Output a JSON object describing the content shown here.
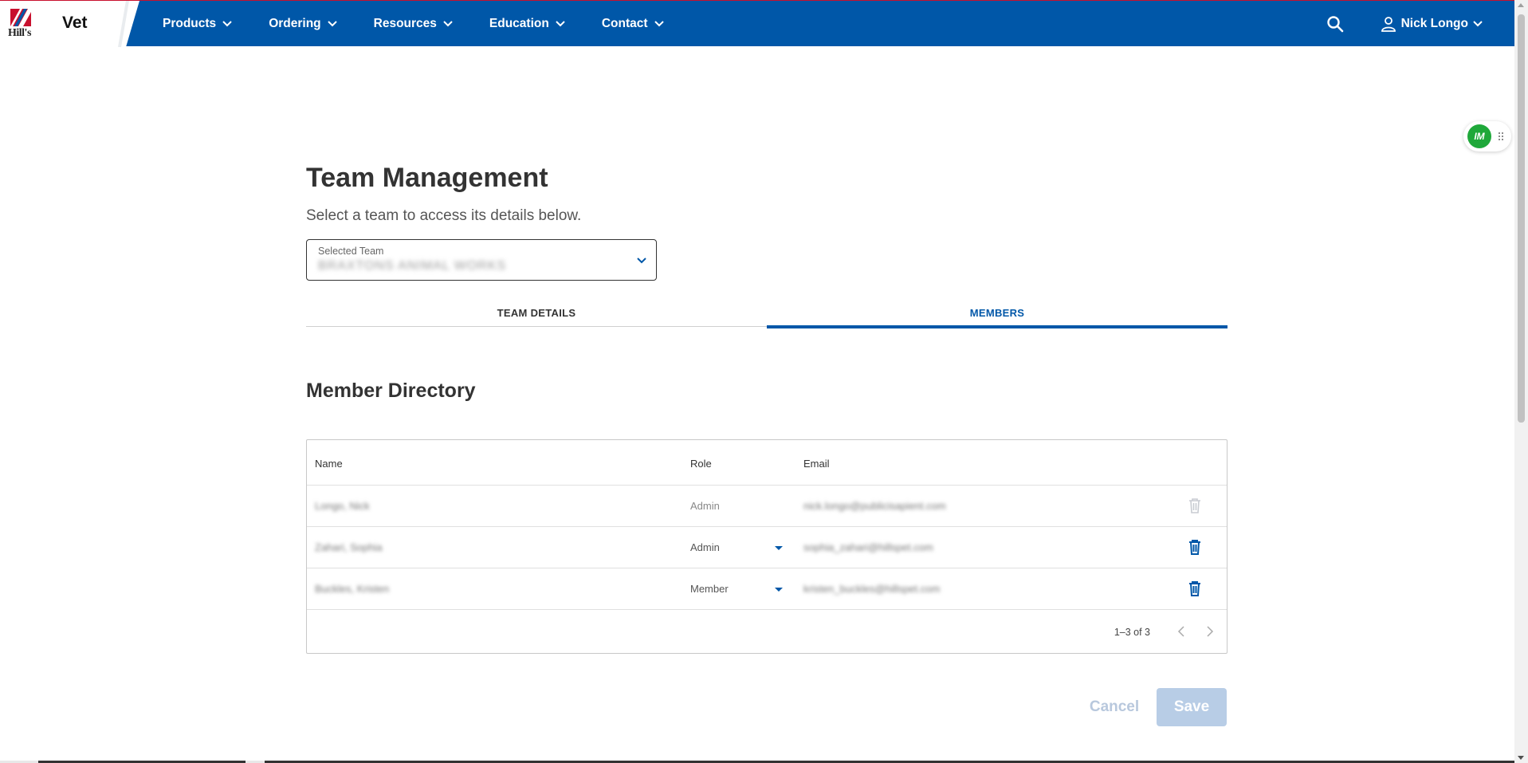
{
  "header": {
    "brand_title": "Vet",
    "logo_text": "Hill's",
    "nav": [
      {
        "label": "Products"
      },
      {
        "label": "Ordering"
      },
      {
        "label": "Resources"
      },
      {
        "label": "Education"
      },
      {
        "label": "Contact"
      }
    ],
    "user_name": "Nick Longo",
    "icons": {
      "search": "search-icon",
      "user": "user-icon",
      "dropdown": "chevron-down-icon"
    }
  },
  "widget": {
    "label": "IM",
    "icon": "drag-handle-icon"
  },
  "main": {
    "title": "Team Management",
    "subtitle": "Select a team to access its details below.",
    "team_select": {
      "label": "Selected Team",
      "value": "BRAXTONS ANIMAL WORKS"
    },
    "tabs": [
      {
        "label": "TEAM DETAILS",
        "active": false
      },
      {
        "label": "MEMBERS",
        "active": true
      }
    ],
    "section_title": "Member Directory",
    "table": {
      "columns": [
        "Name",
        "Role",
        "Email"
      ],
      "rows": [
        {
          "name": "Longo, Nick",
          "role": "Admin",
          "email": "nick.longo@publicisapient.com",
          "role_editable": false,
          "delete_enabled": false
        },
        {
          "name": "Zahari, Sophia",
          "role": "Admin",
          "email": "sophia_zahari@hillspet.com",
          "role_editable": true,
          "delete_enabled": true
        },
        {
          "name": "Buckles, Kristen",
          "role": "Member",
          "email": "kristen_buckles@hillspet.com",
          "role_editable": true,
          "delete_enabled": true
        }
      ],
      "pagination": "1–3 of 3"
    },
    "actions": {
      "cancel": "Cancel",
      "save": "Save"
    }
  },
  "colors": {
    "primary": "#0057a8",
    "brand_red": "#c8102e",
    "disabled_button": "#b8cde6",
    "widget_green": "#1fa83a"
  }
}
